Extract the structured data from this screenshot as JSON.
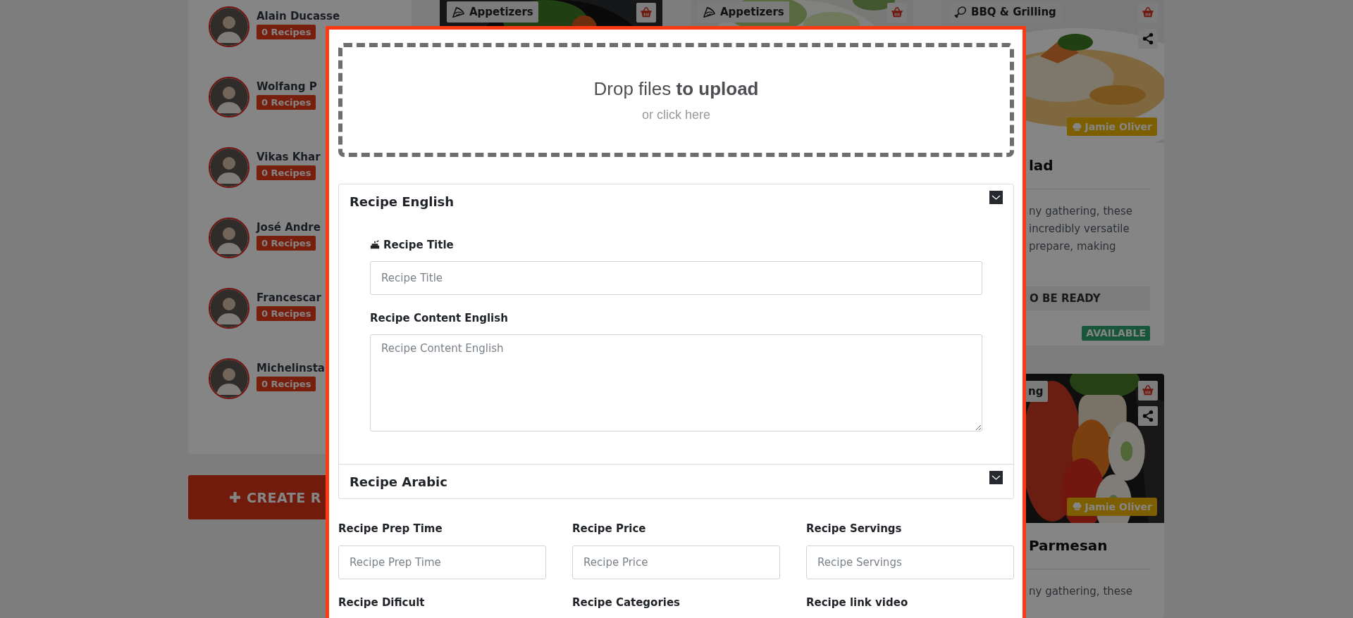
{
  "sidebar": {
    "chefs": [
      {
        "name": "Alain Ducasse",
        "recipe_count": "0 Recipes"
      },
      {
        "name": "Wolfang P",
        "recipe_count": "0 Recipes"
      },
      {
        "name": "Vikas Khar",
        "recipe_count": "0 Recipes"
      },
      {
        "name": "José Andre",
        "recipe_count": "0 Recipes"
      },
      {
        "name": "Francescar",
        "recipe_count": "0 Recipes"
      },
      {
        "name": "Michelinsta",
        "recipe_count": "0 Recipes"
      }
    ],
    "create_button": {
      "label": "CREATE R"
    }
  },
  "recipe_columns": [
    {
      "cards": [
        {
          "tag": {
            "label": "Appetizers",
            "kind": "appetizer"
          }
        }
      ]
    },
    {
      "cards": [
        {
          "tag": {
            "label": "Appetizers",
            "kind": "appetizer"
          }
        }
      ]
    },
    {
      "cards": [
        {
          "tag": {
            "label": "BBQ & Grilling",
            "kind": "grill"
          },
          "author": "Jamie Oliver",
          "title": "lad",
          "description": [
            "ny gathering, these",
            "incredibly versatile",
            "prepare, making"
          ],
          "status": "O BE READY",
          "availability": "AVAILABLE"
        },
        {
          "tag": {
            "label": "ng",
            "kind": "plain"
          },
          "author": "Jamie Oliver",
          "title": "Parmesan",
          "description": [
            "ny gathering, these"
          ]
        }
      ]
    }
  ],
  "modal": {
    "dropzone": {
      "title": "Drop files **to upload**",
      "hint": "or click here"
    },
    "sections": [
      {
        "title": "Recipe English",
        "expanded": true,
        "fields": [
          {
            "kind": "input",
            "label": "Recipe Title",
            "icon": true,
            "placeholder": "Recipe Title"
          },
          {
            "kind": "textarea",
            "label": "Recipe Content English",
            "icon": false,
            "placeholder": "Recipe Content English"
          }
        ]
      },
      {
        "title": "Recipe Arabic",
        "expanded": false
      }
    ],
    "fields": [
      {
        "label": "Recipe Prep Time",
        "placeholder": "Recipe Prep Time"
      },
      {
        "label": "Recipe Price",
        "placeholder": "Recipe Price"
      },
      {
        "label": "Recipe Servings",
        "placeholder": "Recipe Servings"
      },
      {
        "label": "Recipe Dificult"
      },
      {
        "label": "Recipe Categories"
      },
      {
        "label": "Recipe link video"
      }
    ]
  }
}
